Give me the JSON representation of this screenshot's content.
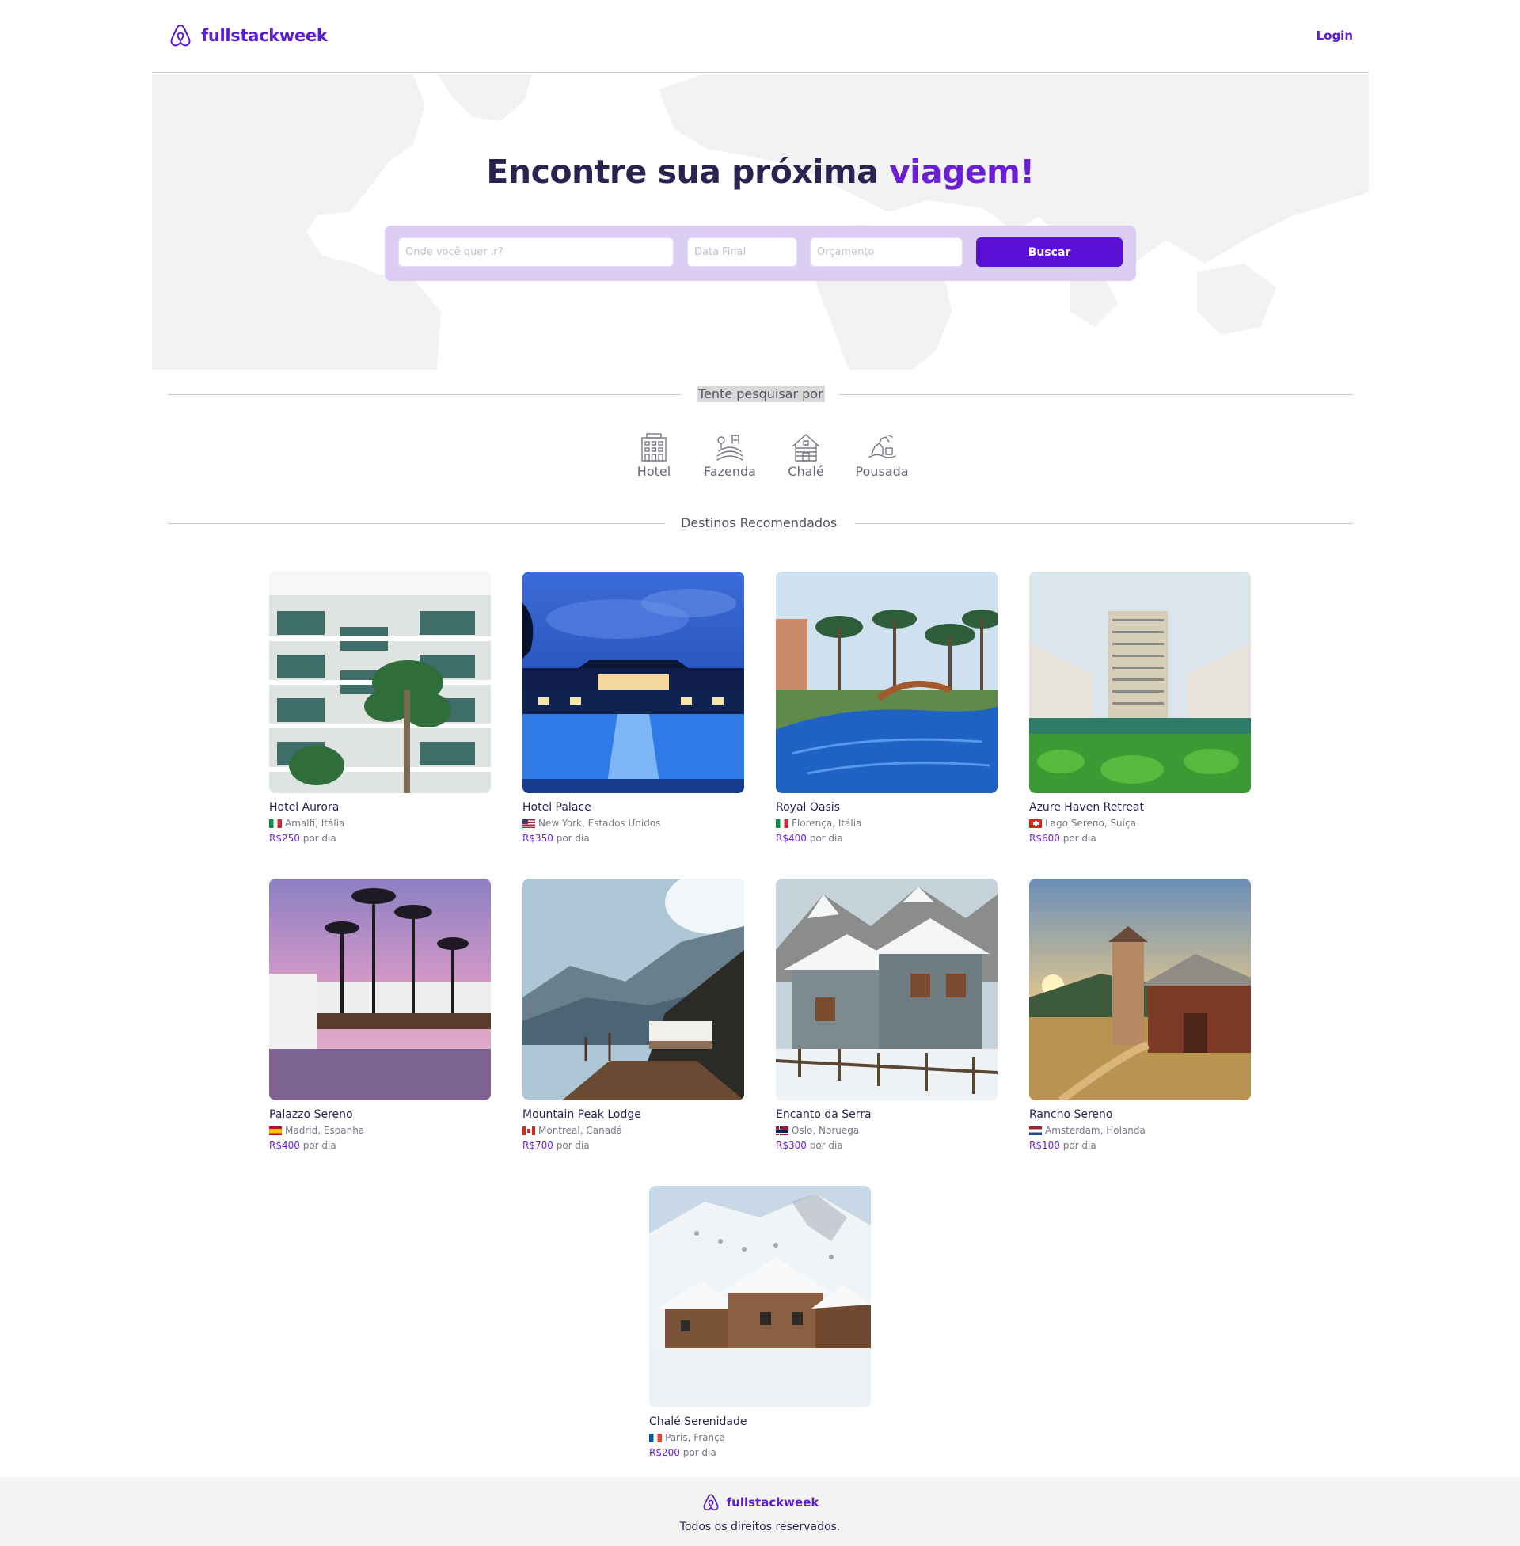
{
  "brand": {
    "name": "fullstackweek",
    "color": "#5a1ad6",
    "icon": "airbnb-logo-icon"
  },
  "header": {
    "login_label": "Login"
  },
  "hero": {
    "title_main": "Encontre sua próxima",
    "title_accent": "viagem!",
    "accent_color": "#6a1fd6"
  },
  "search": {
    "destination_placeholder": "Onde você quer ir?",
    "date_placeholder": "Data Final",
    "budget_placeholder": "Orçamento",
    "button_label": "Buscar",
    "button_color": "#5a0fd6"
  },
  "try_search": {
    "label": "Tente pesquisar por",
    "categories": [
      {
        "label": "Hotel",
        "icon": "hotel-icon"
      },
      {
        "label": "Fazenda",
        "icon": "farm-icon"
      },
      {
        "label": "Chalé",
        "icon": "chalet-icon"
      },
      {
        "label": "Pousada",
        "icon": "inn-icon"
      }
    ]
  },
  "recommended": {
    "label": "Destinos Recomendados",
    "per_day_label": "por dia",
    "trips": [
      {
        "name": "Hotel Aurora",
        "location": "Amalfi, Itália",
        "price": "R$250",
        "flag": "italy"
      },
      {
        "name": "Hotel Palace",
        "location": "New York, Estados Unidos",
        "price": "R$350",
        "flag": "usa"
      },
      {
        "name": "Royal Oasis",
        "location": "Florença, Itália",
        "price": "R$400",
        "flag": "italy"
      },
      {
        "name": "Azure Haven Retreat",
        "location": "Lago Sereno, Suíça",
        "price": "R$600",
        "flag": "switzerland"
      },
      {
        "name": "Palazzo Sereno",
        "location": "Madrid, Espanha",
        "price": "R$400",
        "flag": "spain"
      },
      {
        "name": "Mountain Peak Lodge",
        "location": "Montreal, Canadá",
        "price": "R$700",
        "flag": "canada"
      },
      {
        "name": "Encanto da Serra",
        "location": "Oslo, Noruega",
        "price": "R$300",
        "flag": "norway"
      },
      {
        "name": "Rancho Sereno",
        "location": "Amsterdam, Holanda",
        "price": "R$100",
        "flag": "netherlands"
      },
      {
        "name": "Chalé Serenidade",
        "location": "Paris, França",
        "price": "R$200",
        "flag": "france"
      }
    ]
  },
  "footer": {
    "brand": "fullstackweek",
    "copyright": "Todos os direitos reservados."
  }
}
